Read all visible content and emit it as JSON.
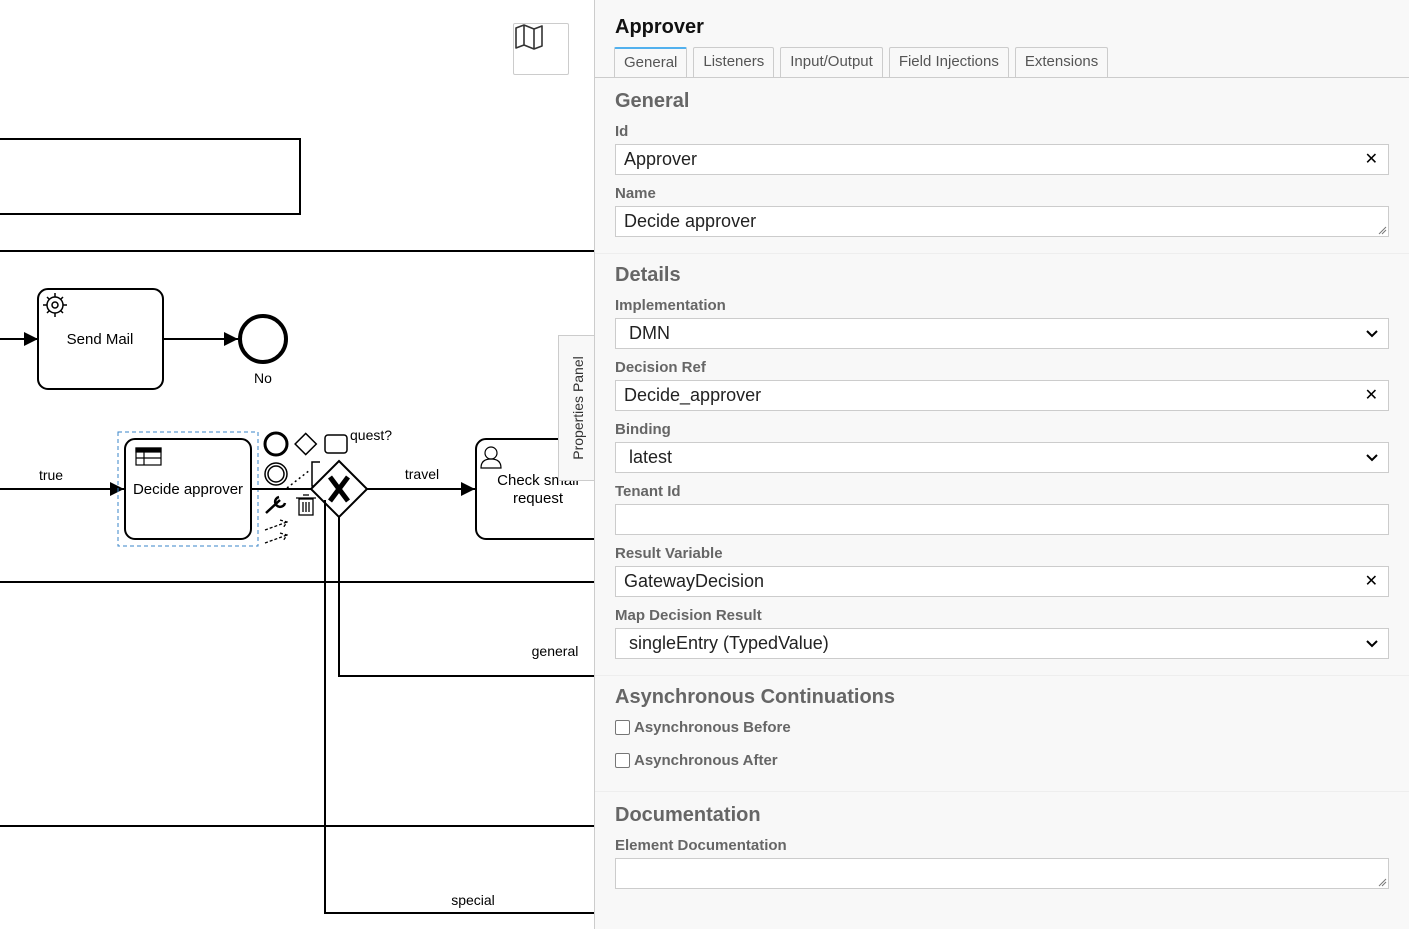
{
  "canvas": {
    "labels": {
      "send_mail": "Send Mail",
      "end_no": "No",
      "flow_true": "true",
      "decide_approver": "Decide approver",
      "request_fragment": "quest?",
      "flow_travel": "travel",
      "check_small_line1": "Check small",
      "check_small_line2": "request",
      "flow_general": "general",
      "flow_special": "special"
    },
    "toggle_label": "Properties Panel"
  },
  "properties": {
    "title": "Approver",
    "tabs": [
      {
        "label": "General",
        "active": true
      },
      {
        "label": "Listeners"
      },
      {
        "label": "Input/Output"
      },
      {
        "label": "Field Injections"
      },
      {
        "label": "Extensions"
      }
    ],
    "general": {
      "heading": "General",
      "id_label": "Id",
      "id_value": "Approver",
      "name_label": "Name",
      "name_value": "Decide approver"
    },
    "details": {
      "heading": "Details",
      "implementation_label": "Implementation",
      "implementation_value": "DMN",
      "decision_ref_label": "Decision Ref",
      "decision_ref_value": "Decide_approver",
      "binding_label": "Binding",
      "binding_value": "latest",
      "tenant_label": "Tenant Id",
      "tenant_value": "",
      "result_var_label": "Result Variable",
      "result_var_value": "GatewayDecision",
      "map_result_label": "Map Decision Result",
      "map_result_value": "singleEntry (TypedValue)"
    },
    "async": {
      "heading": "Asynchronous Continuations",
      "before_label": "Asynchronous Before",
      "after_label": "Asynchronous After"
    },
    "documentation": {
      "heading": "Documentation",
      "element_doc_label": "Element Documentation",
      "element_doc_value": ""
    }
  }
}
